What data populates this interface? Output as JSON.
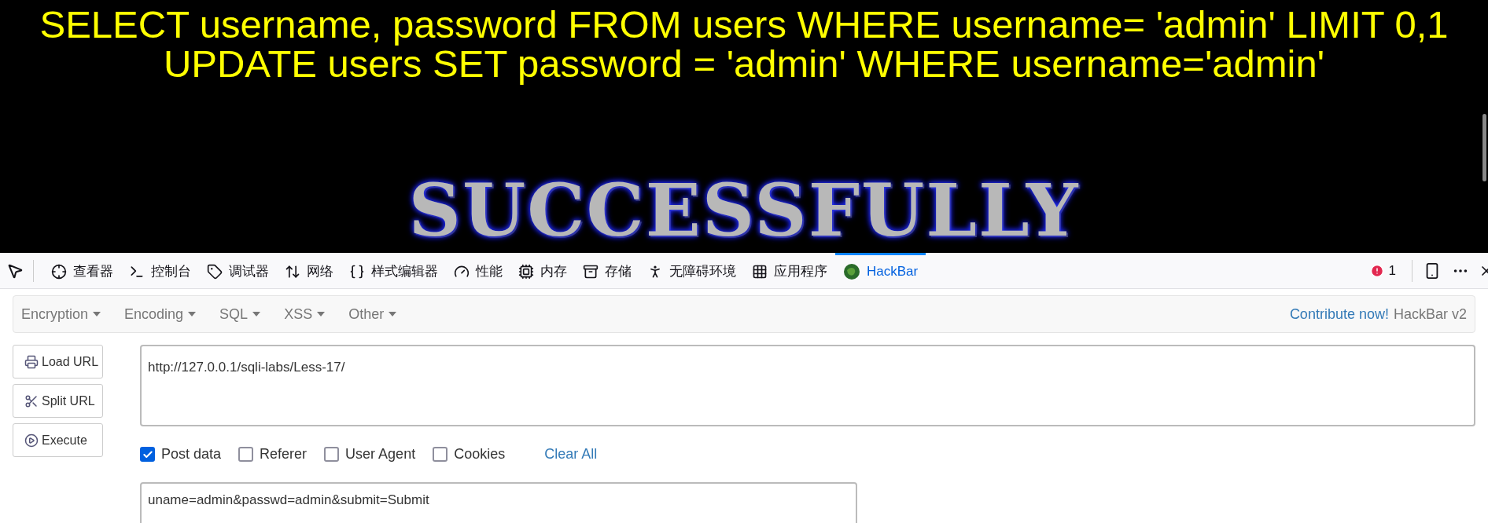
{
  "page": {
    "query_lines": [
      "SELECT username, password FROM users WHERE username= 'admin' LIMIT 0,1",
      "UPDATE users SET password = 'admin' WHERE username='admin'"
    ],
    "banner_text": "SUCCESSFULLY"
  },
  "devtools": {
    "tabs": [
      {
        "label": "查看器",
        "selected": false
      },
      {
        "label": "控制台",
        "selected": false
      },
      {
        "label": "调试器",
        "selected": false
      },
      {
        "label": "网络",
        "selected": false
      },
      {
        "label": "样式编辑器",
        "selected": false
      },
      {
        "label": "性能",
        "selected": false
      },
      {
        "label": "内存",
        "selected": false
      },
      {
        "label": "存储",
        "selected": false
      },
      {
        "label": "无障碍环境",
        "selected": false
      },
      {
        "label": "应用程序",
        "selected": false
      },
      {
        "label": "HackBar",
        "selected": true
      }
    ],
    "error_count": "1"
  },
  "hackbar": {
    "menus": [
      "Encryption",
      "Encoding",
      "SQL",
      "XSS",
      "Other"
    ],
    "contribute_link": "Contribute now!",
    "version": "HackBar v2",
    "buttons": [
      "Load URL",
      "Split URL",
      "Execute"
    ],
    "url": "http://127.0.0.1/sqli-labs/Less-17/",
    "options": [
      {
        "label": "Post data",
        "checked": true
      },
      {
        "label": "Referer",
        "checked": false
      },
      {
        "label": "User Agent",
        "checked": false
      },
      {
        "label": "Cookies",
        "checked": false
      }
    ],
    "clear_all": "Clear All",
    "post_body": "uname=admin&passwd=admin&submit=Submit"
  }
}
